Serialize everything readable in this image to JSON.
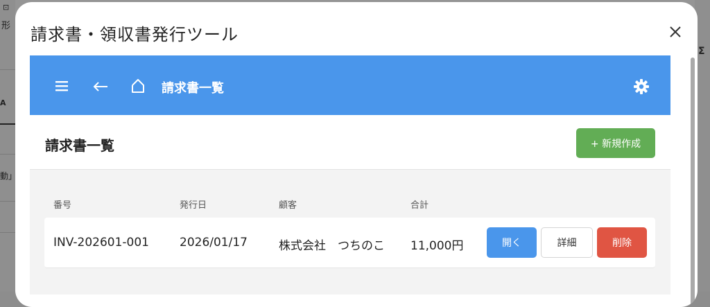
{
  "background_app": {
    "glyph_top_left": "形",
    "glyph_mid_left": "A",
    "glyph_low_left": "動」",
    "glyph_right": "Σ"
  },
  "modal": {
    "title": "請求書・領収書発行ツール",
    "close_icon": "close-icon"
  },
  "topbar": {
    "color": "#4a96eb",
    "menu_icon": "hamburger-menu-icon",
    "back_icon": "back-arrow-icon",
    "home_icon": "home-icon",
    "title": "請求書一覧",
    "settings_icon": "gear-icon"
  },
  "page": {
    "title": "請求書一覧",
    "new_button_label": "+ 新規作成",
    "new_button_color": "#62ad55"
  },
  "table": {
    "columns": [
      "番号",
      "発行日",
      "顧客",
      "合計"
    ],
    "rows": [
      {
        "number": "INV-202601-001",
        "issue_date": "2026/01/17",
        "customer": "株式会社　つちのこ",
        "total": "11,000円",
        "open_label": "開く",
        "detail_label": "詳細",
        "delete_label": "削除"
      }
    ]
  },
  "colors": {
    "open": "#4a96eb",
    "delete": "#e05543"
  }
}
